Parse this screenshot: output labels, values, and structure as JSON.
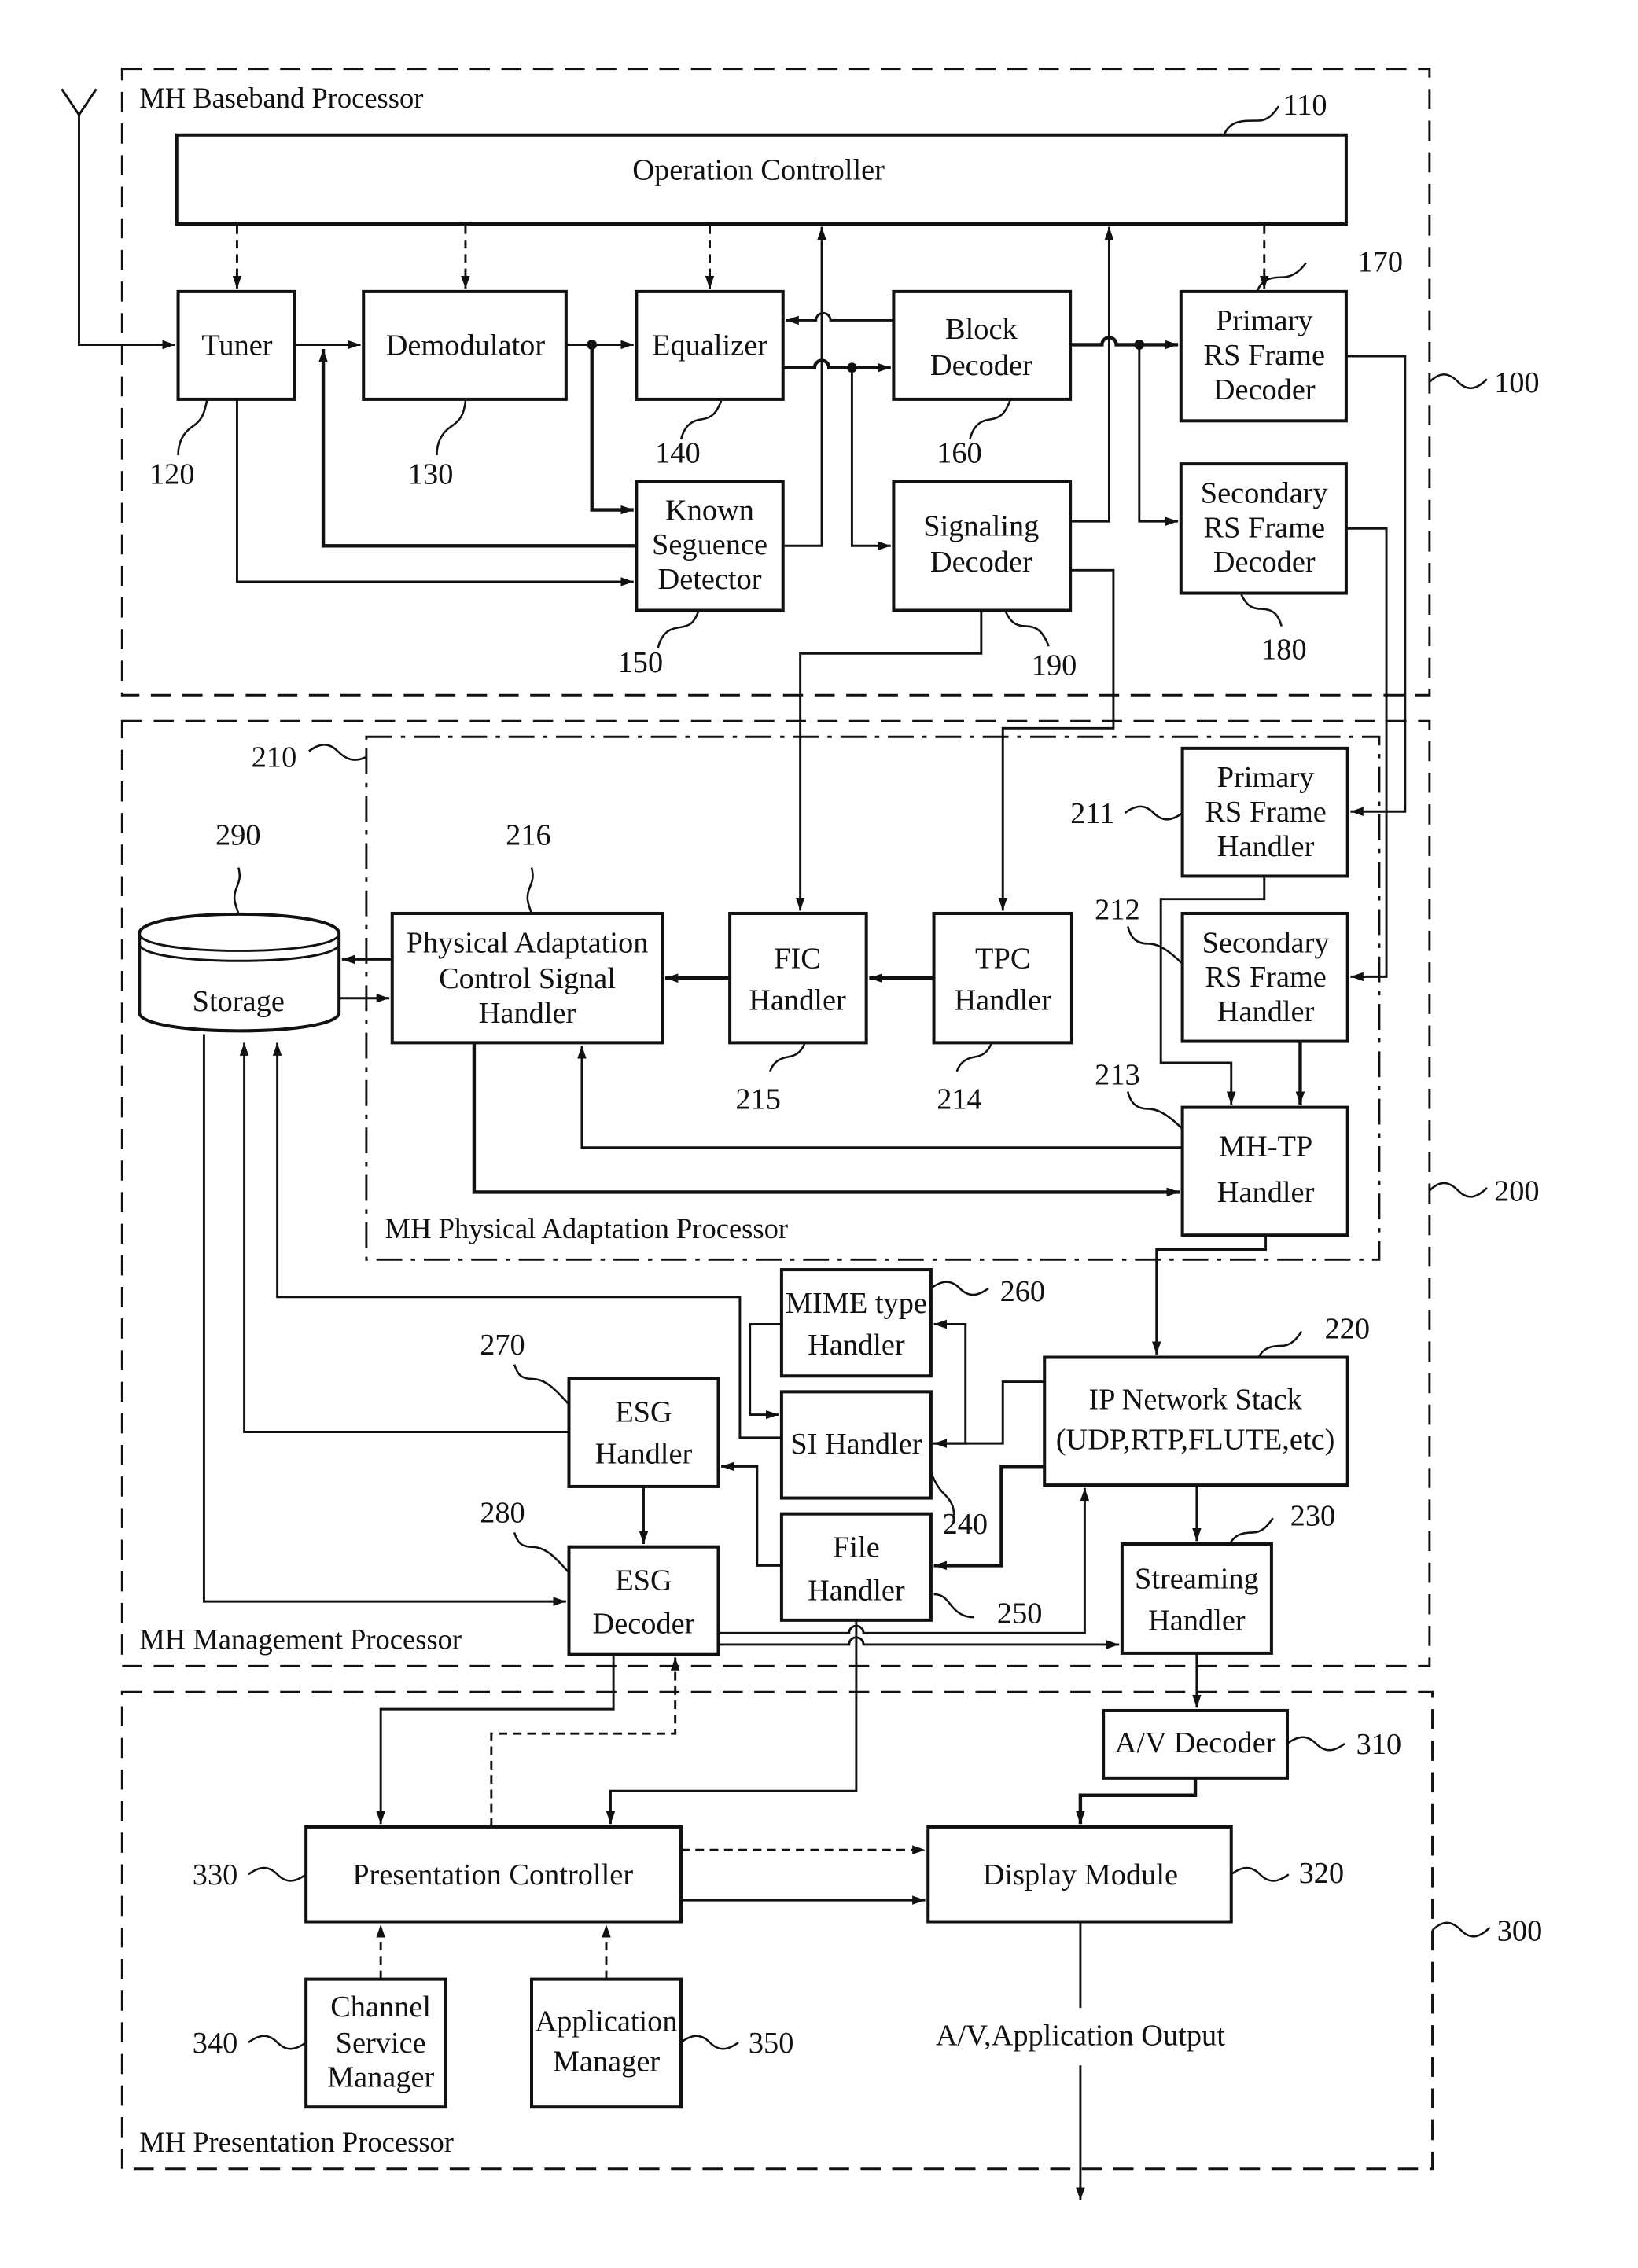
{
  "figure": {
    "groups": {
      "baseband": {
        "title": "MH Baseband Processor",
        "ref": "100"
      },
      "management": {
        "title": "MH Management Processor",
        "ref": "200"
      },
      "physical_adaptation": {
        "title": "MH Physical Adaptation Processor",
        "ref": "210"
      },
      "presentation": {
        "title": "MH Presentation Processor",
        "ref": "300"
      }
    },
    "blocks": {
      "operation_controller": {
        "lines": [
          "Operation Controller"
        ],
        "ref": "110"
      },
      "tuner": {
        "lines": [
          "Tuner"
        ],
        "ref": "120"
      },
      "demodulator": {
        "lines": [
          "Demodulator"
        ],
        "ref": "130"
      },
      "equalizer": {
        "lines": [
          "Equalizer"
        ],
        "ref": "140"
      },
      "known_sequence_detector": {
        "lines": [
          "Known",
          "Seguence",
          "Detector"
        ],
        "ref": "150"
      },
      "block_decoder": {
        "lines": [
          "Block",
          "Decoder"
        ],
        "ref": "160"
      },
      "primary_rs_frame_decoder": {
        "lines": [
          "Primary",
          "RS Frame",
          "Decoder"
        ],
        "ref": "170"
      },
      "secondary_rs_frame_decoder": {
        "lines": [
          "Secondary",
          "RS Frame",
          "Decoder"
        ],
        "ref": "180"
      },
      "signaling_decoder": {
        "lines": [
          "Signaling",
          "Decoder"
        ],
        "ref": "190"
      },
      "primary_rs_frame_handler": {
        "lines": [
          "Primary",
          "RS Frame",
          "Handler"
        ],
        "ref": "211"
      },
      "secondary_rs_frame_handler": {
        "lines": [
          "Secondary",
          "RS Frame",
          "Handler"
        ],
        "ref": "212"
      },
      "mh_tp_handler": {
        "lines": [
          "MH-TP",
          "Handler"
        ],
        "ref": "213"
      },
      "tpc_handler": {
        "lines": [
          "TPC",
          "Handler"
        ],
        "ref": "214"
      },
      "fic_handler": {
        "lines": [
          "FIC",
          "Handler"
        ],
        "ref": "215"
      },
      "pacs_handler": {
        "lines": [
          "Physical Adaptation",
          "Control Signal",
          "Handler"
        ],
        "ref": "216"
      },
      "ip_network_stack": {
        "lines": [
          "IP Network Stack",
          "(UDP,RTP,FLUTE,etc)"
        ],
        "ref": "220"
      },
      "streaming_handler": {
        "lines": [
          "Streaming",
          "Handler"
        ],
        "ref": "230"
      },
      "si_handler": {
        "lines": [
          "SI Handler"
        ],
        "ref": "240"
      },
      "file_handler": {
        "lines": [
          "File",
          "Handler"
        ],
        "ref": "250"
      },
      "mime_type_handler": {
        "lines": [
          "MIME type",
          "Handler"
        ],
        "ref": "260"
      },
      "esg_handler": {
        "lines": [
          "ESG",
          "Handler"
        ],
        "ref": "270"
      },
      "esg_decoder": {
        "lines": [
          "ESG",
          "Decoder"
        ],
        "ref": "280"
      },
      "storage": {
        "lines": [
          "Storage"
        ],
        "ref": "290"
      },
      "av_decoder": {
        "lines": [
          "A/V Decoder"
        ],
        "ref": "310"
      },
      "display_module": {
        "lines": [
          "Display Module"
        ],
        "ref": "320"
      },
      "presentation_controller": {
        "lines": [
          "Presentation Controller"
        ],
        "ref": "330"
      },
      "channel_service_manager": {
        "lines": [
          "Channel",
          "Service",
          "Manager"
        ],
        "ref": "340"
      },
      "application_manager": {
        "lines": [
          "Application",
          "Manager"
        ],
        "ref": "350"
      }
    },
    "output_label": "A/V,Application Output"
  }
}
